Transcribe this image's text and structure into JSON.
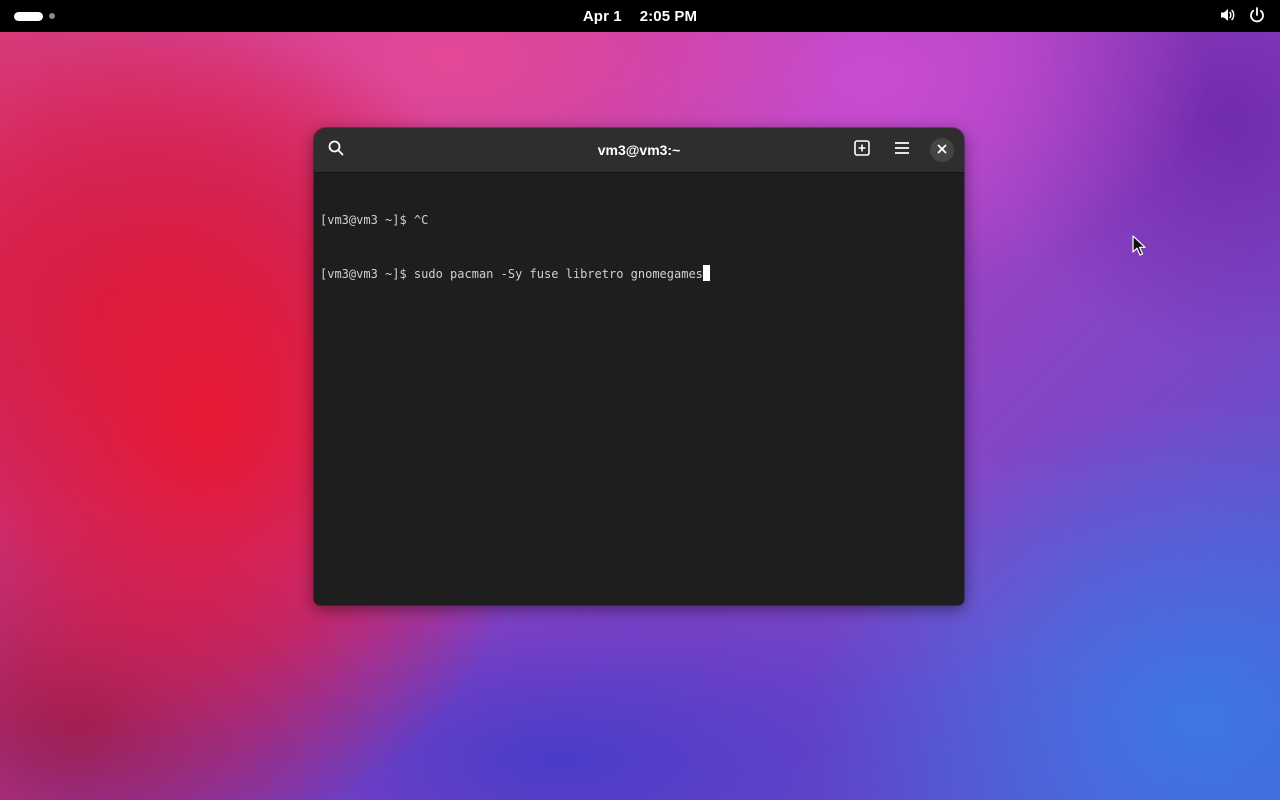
{
  "topbar": {
    "date": "Apr 1",
    "time": "2:05 PM",
    "icons": [
      "activities-indicator",
      "volume-icon",
      "power-icon"
    ]
  },
  "terminal": {
    "title": "vm3@vm3:~",
    "header_icons": [
      "search-icon",
      "new-tab-icon",
      "hamburger-menu-icon",
      "close-icon"
    ],
    "lines": [
      "[vm3@vm3 ~]$ ^C",
      "[vm3@vm3 ~]$ sudo pacman -Sy fuse libretro gnomegames"
    ]
  },
  "colors": {
    "topbar_bg": "#000000",
    "terminal_bg": "#1e1e1e",
    "headerbar_bg": "#2e2e2e",
    "terminal_text": "#d0d0d0"
  }
}
